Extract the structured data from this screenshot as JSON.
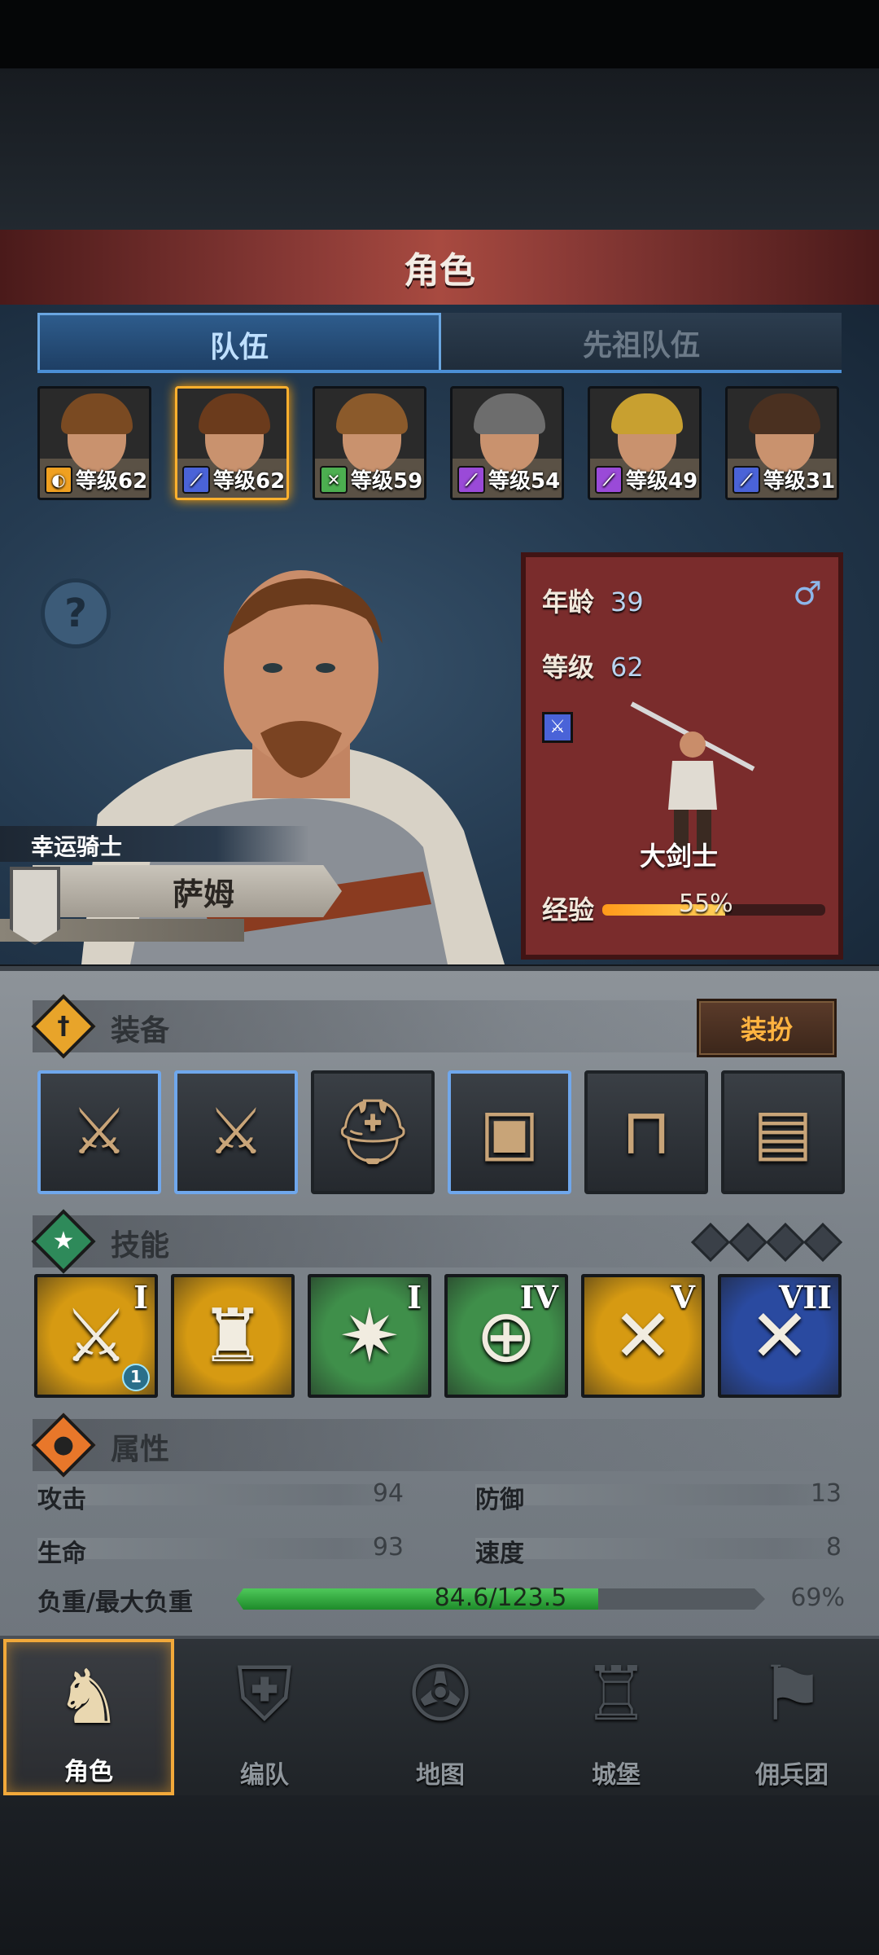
{
  "header": {
    "title": "角色"
  },
  "tabs": [
    {
      "label": "队伍"
    },
    {
      "label": "先祖队伍"
    }
  ],
  "roster": [
    {
      "level": "等级62",
      "class_icon": "shield-icon",
      "class_color": "#f0a020",
      "hair": "#7a4a22",
      "selected": false
    },
    {
      "level": "等级62",
      "class_icon": "sword-icon",
      "class_color": "#4a63d8",
      "hair": "#6b3b1c",
      "selected": true
    },
    {
      "level": "等级59",
      "class_icon": "crossed-swords-icon",
      "class_color": "#4caf50",
      "hair": "#8b5a2b",
      "selected": false
    },
    {
      "level": "等级54",
      "class_icon": "staff-icon",
      "class_color": "#9a4ad8",
      "hair": "#6d6d6d",
      "selected": false
    },
    {
      "level": "等级49",
      "class_icon": "staff-icon",
      "class_color": "#9a4ad8",
      "hair": "#c8a030",
      "selected": false
    },
    {
      "level": "等级31",
      "class_icon": "sword-icon",
      "class_color": "#4a63d8",
      "hair": "#4a3020",
      "selected": false
    }
  ],
  "hero": {
    "title": "幸运骑士",
    "name": "萨姆",
    "age_label": "年龄",
    "age": "39",
    "level_label": "等级",
    "level": "62",
    "gender_symbol": "♂",
    "class_name": "大剑士",
    "exp_label": "经验",
    "exp_percent": "55%",
    "exp_fraction": 0.55
  },
  "equipment": {
    "title": "装备",
    "outfit_button": "装扮",
    "slots": [
      {
        "icon": "greatsword-icon",
        "highlight": true
      },
      {
        "icon": "greatsword-icon",
        "highlight": true
      },
      {
        "icon": "helmet-icon",
        "highlight": false
      },
      {
        "icon": "armor-icon",
        "highlight": true
      },
      {
        "icon": "boots-icon",
        "highlight": false
      },
      {
        "icon": "book-icon",
        "highlight": false
      }
    ]
  },
  "skills": {
    "title": "技能",
    "items": [
      {
        "rank": "I",
        "bg": "#d69a12",
        "icon": "claw-sword-icon",
        "badge": "1"
      },
      {
        "rank": "",
        "bg": "#d69a12",
        "icon": "summon-icon",
        "badge": ""
      },
      {
        "rank": "I",
        "bg": "#3f8f4a",
        "icon": "burst-icon",
        "badge": ""
      },
      {
        "rank": "IV",
        "bg": "#3f8f4a",
        "icon": "crosshair-icon",
        "badge": ""
      },
      {
        "rank": "V",
        "bg": "#d69a12",
        "icon": "crossed-swords-icon",
        "badge": ""
      },
      {
        "rank": "VII",
        "bg": "#2a4aa0",
        "icon": "crossed-swords-icon",
        "badge": ""
      }
    ]
  },
  "attributes": {
    "title": "属性",
    "attack_label": "攻击",
    "attack": "94",
    "defense_label": "防御",
    "defense": "13",
    "hp_label": "生命",
    "hp": "93",
    "speed_label": "速度",
    "speed": "8",
    "load_label": "负重/最大负重",
    "load_value": "84.6/123.5",
    "load_percent": "69%",
    "load_fraction": 0.685
  },
  "nav": [
    {
      "label": "角色",
      "icon": "knight-icon",
      "active": true
    },
    {
      "label": "编队",
      "icon": "helmet-formation-icon",
      "active": false
    },
    {
      "label": "地图",
      "icon": "compass-map-icon",
      "active": false
    },
    {
      "label": "城堡",
      "icon": "castle-icon",
      "active": false
    },
    {
      "label": "佣兵团",
      "icon": "mercenary-icon",
      "active": false
    }
  ],
  "colors": {
    "accent": "#f2a93a",
    "tab_active": "#4b8fd6",
    "banner": "#8a3a36"
  }
}
